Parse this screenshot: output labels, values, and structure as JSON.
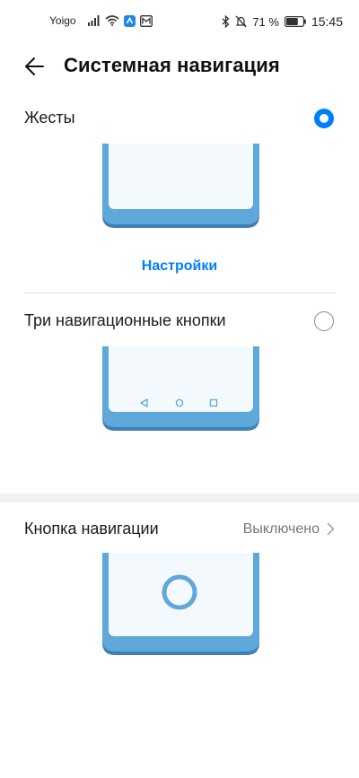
{
  "status_bar": {
    "carrier": "Yoigo",
    "battery_percent": "71 %",
    "time": "15:45",
    "battery_level": 0.71
  },
  "header": {
    "title": "Системная навигация",
    "back_icon": "arrow-left-icon"
  },
  "options": {
    "gestures": {
      "label": "Жесты",
      "selected": true
    },
    "settings_link": "Настройки",
    "three_buttons": {
      "label": "Три навигационные кнопки",
      "selected": false
    }
  },
  "nav_button": {
    "label": "Кнопка навигации",
    "value": "Выключено"
  },
  "colors": {
    "accent": "#007dff",
    "phone_body": "#5ea8da",
    "phone_shadow": "#3f7fb5",
    "phone_screen": "#f3f9fc"
  }
}
